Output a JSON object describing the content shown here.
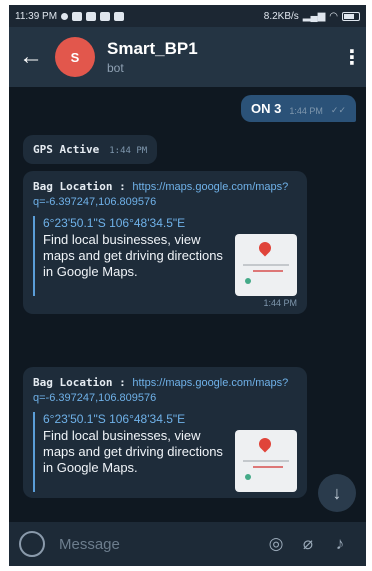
{
  "status_bar": {
    "time": "11:39 PM",
    "speed": "8.2KB/s"
  },
  "app_bar": {
    "back_icon": "arrow-left-icon",
    "avatar_letter": "S",
    "title": "Smart_BP1",
    "subtitle": "bot",
    "menu_icon": "more-vert-icon"
  },
  "messages": {
    "outgoing": {
      "text": "ON 3",
      "time": "1:44 PM"
    },
    "gps": {
      "text": "GPS Active",
      "time": "1:44 PM"
    },
    "locations": [
      {
        "label": "Bag Location",
        "separator": " : ",
        "link": "https://maps.google.com/maps?q=-6.397247,106.809576",
        "preview_title": "6°23'50.1\"S 106°48'34.5\"E",
        "preview_desc": "Find local businesses, view maps and get driving directions in Google Maps.",
        "time": "1:44 PM"
      },
      {
        "label": "Bag Location",
        "separator": " : ",
        "link": "https://maps.google.com/maps?q=-6.397247,106.809576",
        "preview_title": "6°23'50.1\"S 106°48'34.5\"E",
        "preview_desc": "Find local businesses, view maps and get driving directions in Google Maps.",
        "time": ""
      }
    ]
  },
  "input_bar": {
    "placeholder": "Message"
  },
  "colors": {
    "accent": "#6fb1e8",
    "avatar": "#e2574c",
    "outgoing_bubble": "#2b5278",
    "incoming_bubble": "#1e2c3a"
  }
}
